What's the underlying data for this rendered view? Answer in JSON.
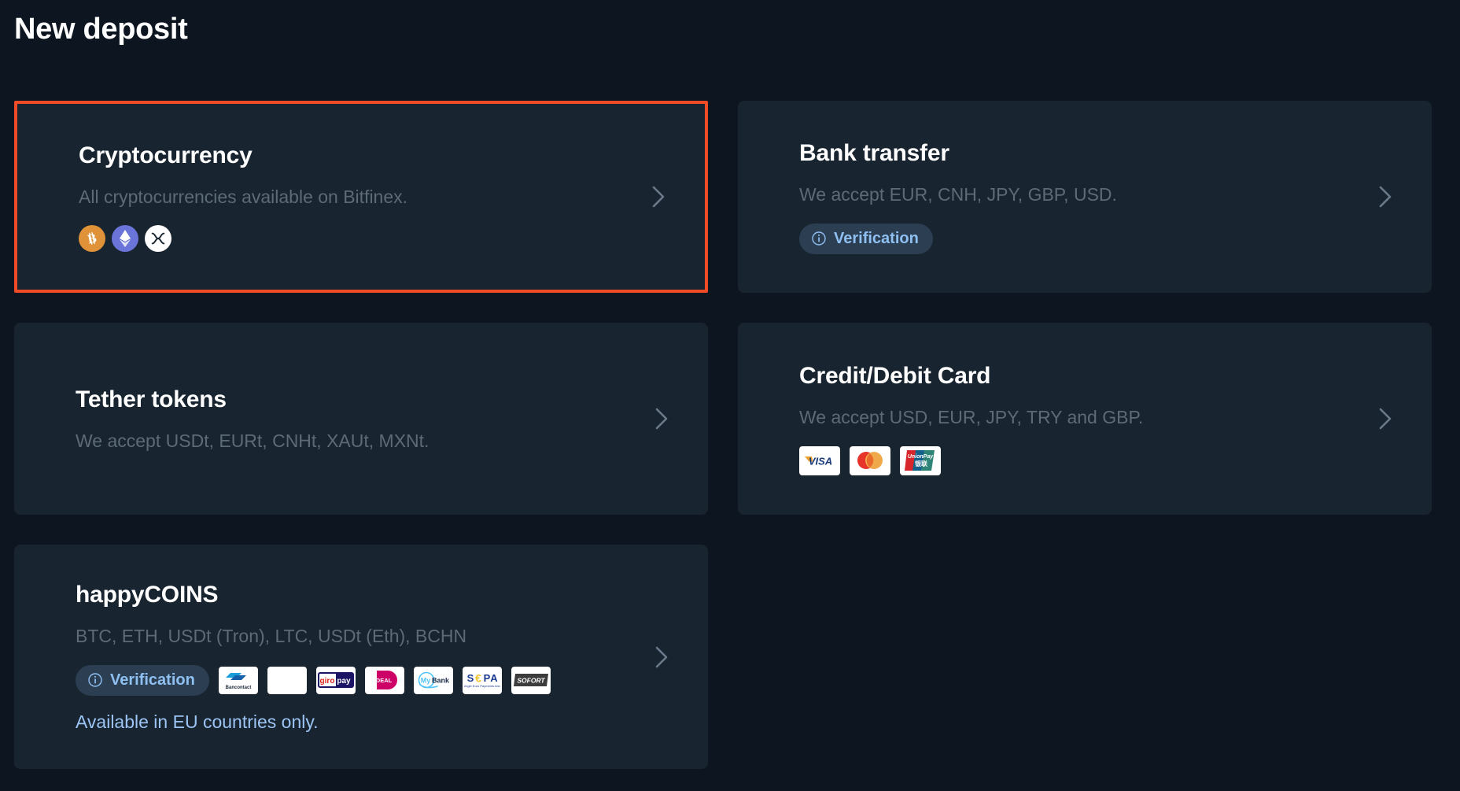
{
  "page": {
    "title": "New deposit",
    "background_color": "#0d1620",
    "card_background_color": "#18242f",
    "highlight_border_color": "#ef4b26",
    "link_color": "#9cc4f5",
    "muted_text_color": "#5d6b78"
  },
  "cards": [
    {
      "id": "cryptocurrency",
      "title": "Cryptocurrency",
      "subtitle": "All cryptocurrencies available on Bitfinex.",
      "selected": true,
      "coins": [
        {
          "name": "bitcoin-icon",
          "symbol": "BTC",
          "color": "#df9238"
        },
        {
          "name": "ethereum-icon",
          "symbol": "ETH",
          "color": "#6b74d8"
        },
        {
          "name": "xrp-icon",
          "symbol": "XRP",
          "color": "#ffffff"
        }
      ],
      "chevron": "chevron-right-icon"
    },
    {
      "id": "bank-transfer",
      "title": "Bank transfer",
      "subtitle": "We accept EUR, CNH, JPY, GBP, USD.",
      "selected": false,
      "badge": {
        "label": "Verification",
        "icon": "info-icon"
      },
      "chevron": "chevron-right-icon"
    },
    {
      "id": "tether-tokens",
      "title": "Tether tokens",
      "subtitle": "We accept USDt, EURt, CNHt, XAUt, MXNt.",
      "selected": false,
      "chevron": "chevron-right-icon"
    },
    {
      "id": "credit-debit-card",
      "title": "Credit/Debit Card",
      "subtitle": "We accept USD, EUR, JPY, TRY and GBP.",
      "selected": false,
      "payment_logos": [
        {
          "name": "visa-logo",
          "label": "VISA"
        },
        {
          "name": "mastercard-logo",
          "label": "Mastercard"
        },
        {
          "name": "unionpay-logo",
          "label": "UnionPay"
        }
      ],
      "chevron": "chevron-right-icon"
    },
    {
      "id": "happycoins",
      "title": "happyCOINS",
      "subtitle": "BTC, ETH, USDt (Tron), LTC, USDt (Eth), BCHN",
      "selected": false,
      "badge": {
        "label": "Verification",
        "icon": "info-icon"
      },
      "payment_logos": [
        {
          "name": "bancontact-logo",
          "label": "Bancontact"
        },
        {
          "name": "blank-logo",
          "label": ""
        },
        {
          "name": "giropay-logo",
          "label": "giropay"
        },
        {
          "name": "ideal-logo",
          "label": "iDEAL"
        },
        {
          "name": "mybank-logo",
          "label": "MyBank"
        },
        {
          "name": "sepa-logo",
          "label": "SEPA"
        },
        {
          "name": "sofort-logo",
          "label": "SOFORT"
        }
      ],
      "note": "Available in EU countries only.",
      "chevron": "chevron-right-icon"
    }
  ]
}
